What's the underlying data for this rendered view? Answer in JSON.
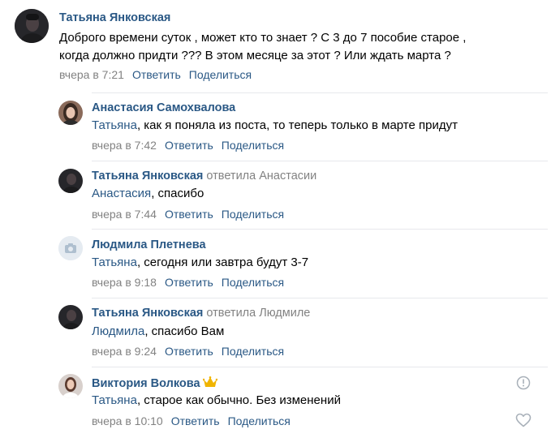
{
  "comments": [
    {
      "author": "Татьяна Янковская",
      "lines": [
        "Доброго времени суток , может кто то знает ? С 3 до 7 пособие старое ,",
        "когда должно придти ??? В этом месяце за этот ? Или ждать марта ?"
      ],
      "time": "вчера в 7:21",
      "reply_label": "Ответить",
      "share_label": "Поделиться",
      "avatar": "dark-photo"
    },
    {
      "author": "Анастасия Самохвалова",
      "addressee": "Татьяна",
      "text": ", как я поняла из поста, то теперь только в марте придут",
      "time": "вчера в 7:42",
      "reply_label": "Ответить",
      "share_label": "Поделиться",
      "avatar": "woman-photo"
    },
    {
      "author": "Татьяна Янковская",
      "replied_to": "ответила Анастасии",
      "addressee": "Анастасия",
      "text": ", спасибо",
      "time": "вчера в 7:44",
      "reply_label": "Ответить",
      "share_label": "Поделиться",
      "avatar": "dark-photo"
    },
    {
      "author": "Людмила Плетнева",
      "addressee": "Татьяна",
      "text": ", сегодня или завтра будут 3-7",
      "time": "вчера в 9:18",
      "reply_label": "Ответить",
      "share_label": "Поделиться",
      "avatar": "camera-placeholder-icon"
    },
    {
      "author": "Татьяна Янковская",
      "replied_to": "ответила Людмиле",
      "addressee": "Людмила",
      "text": ", спасибо Вам",
      "time": "вчера в 9:24",
      "reply_label": "Ответить",
      "share_label": "Поделиться",
      "avatar": "dark-photo"
    },
    {
      "author": "Виктория Волкова",
      "addressee": "Татьяна",
      "text": ", старое как обычно. Без изменений",
      "time": "вчера в 10:10",
      "reply_label": "Ответить",
      "share_label": "Поделиться",
      "avatar": "woman-photo-light",
      "badge_icon": "crown-icon",
      "side_icons": [
        "report-icon",
        "like-heart-icon"
      ]
    }
  ],
  "colors": {
    "link": "#2a5885",
    "meta": "#828282",
    "separator": "#e7e8ec",
    "crown": "#f0b400"
  }
}
